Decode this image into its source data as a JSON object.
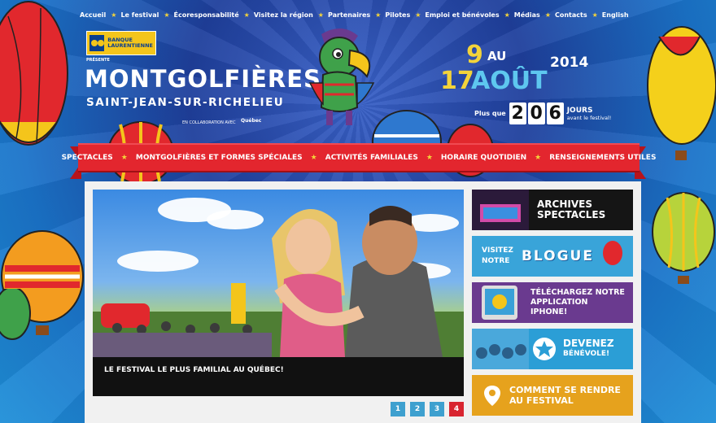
{
  "top_nav": [
    {
      "label": "Accueil"
    },
    {
      "label": "Le festival"
    },
    {
      "label": "Écoresponsabilité"
    },
    {
      "label": "Visitez la région"
    },
    {
      "label": "Partenaires"
    },
    {
      "label": "Pilotes"
    },
    {
      "label": "Emploi et bénévoles"
    },
    {
      "label": "Médias"
    },
    {
      "label": "Contacts"
    },
    {
      "label": "English"
    }
  ],
  "sponsor": {
    "line1": "BANQUE",
    "line2": "LAURENTIENNE",
    "presents": "PRÉSENTE"
  },
  "festival": {
    "title": "MONTGOLFIÈRES",
    "subtitle": "SAINT-JEAN-SUR-RICHELIEU",
    "collab": "EN COLLABORATION AVEC",
    "partner": "Québec"
  },
  "dates": {
    "day1": "9",
    "au": "AU",
    "day2": "17",
    "month": "AOÛT",
    "year": "2014"
  },
  "countdown": {
    "prefix": "Plus que",
    "digits": [
      "2",
      "0",
      "6"
    ],
    "unit": "JOURS",
    "suffix": "avant le festival!"
  },
  "main_nav": [
    {
      "label": "SPECTACLES"
    },
    {
      "label": "MONTGOLFIÈRES ET FORMES SPÉCIALES"
    },
    {
      "label": "ACTIVITÉS FAMILIALES"
    },
    {
      "label": "HORAIRE QUOTIDIEN"
    },
    {
      "label": "RENSEIGNEMENTS UTILES"
    }
  ],
  "hero": {
    "caption": "LE FESTIVAL LE PLUS FAMILIAL AU QUÉBEC!"
  },
  "pager": {
    "pages": [
      "1",
      "2",
      "3",
      "4"
    ],
    "active": 3
  },
  "tiles": [
    {
      "l1": "ARCHIVES",
      "l2": "SPECTACLES"
    },
    {
      "l1": "VISITEZ",
      "l2": "NOTRE",
      "big": "BLOGUE"
    },
    {
      "l1": "TÉLÉCHARGEZ NOTRE",
      "l2": "APPLICATION",
      "l3": "IPHONE!"
    },
    {
      "l1": "DEVENEZ",
      "l2": "BÉNÉVOLE!"
    },
    {
      "l1": "COMMENT SE RENDRE",
      "l2": "AU FESTIVAL"
    }
  ],
  "colors": {
    "banner_red": "#e3262e",
    "accent_yellow": "#f3d33a",
    "sky_blue": "#1f8fd8",
    "date_blue": "#5ec7ef"
  }
}
